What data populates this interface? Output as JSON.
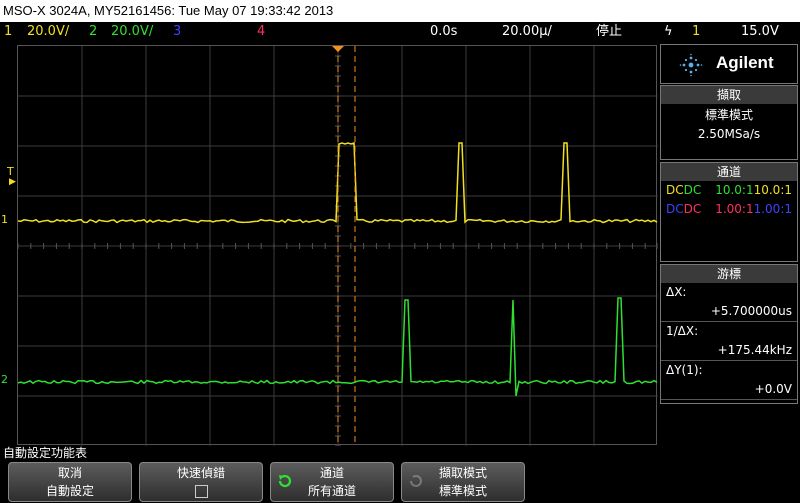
{
  "title": "MSO-X 3024A, MY52161456: Tue May 07 19:33:42 2013",
  "status": {
    "ch1_num": "1",
    "ch1_scale": "20.0V/",
    "ch2_num": "2",
    "ch2_scale": "20.0V/",
    "ch3_num": "3",
    "ch4_num": "4",
    "delay": "0.0s",
    "timebase": "20.00µ/",
    "run_state": "停止",
    "trig_icon": "ϟ",
    "trig_src": "1",
    "trig_level": "15.0V"
  },
  "colors": {
    "ch1": "#f0e020",
    "ch2": "#30e030",
    "ch3": "#4040ff",
    "ch4": "#ff3060",
    "cursor": "#f09020"
  },
  "markers": {
    "trig": "T",
    "ch1": "1",
    "ch2": "2"
  },
  "brand": {
    "name": "Agilent",
    "icon": "agilent-spark-icon"
  },
  "acquisition": {
    "header": "擷取",
    "mode": "標準模式",
    "rate": "2.50MSa/s"
  },
  "channels": {
    "header": "通道",
    "rows": [
      {
        "coupling": "DC",
        "ratio": "10.0:1"
      },
      {
        "coupling": "DC",
        "ratio": "10.0:1"
      },
      {
        "coupling": "DC",
        "ratio": "1.00:1"
      },
      {
        "coupling": "DC",
        "ratio": "1.00:1"
      }
    ]
  },
  "cursors": {
    "header": "游標",
    "dx_label": "ΔX:",
    "dx_value": "+5.700000us",
    "inv_label": "1/ΔX:",
    "inv_value": "+175.44kHz",
    "dy_label": "ΔY(1):",
    "dy_value": "+0.0V"
  },
  "softkeys": {
    "menu_title": "自動設定功能表",
    "keys": [
      {
        "line1": "取消",
        "line2": "自動設定"
      },
      {
        "line1": "快速偵錯",
        "line2": ""
      },
      {
        "line1": "通道",
        "line2": "所有通道"
      },
      {
        "line1": "擷取模式",
        "line2": "標準模式"
      }
    ]
  }
}
